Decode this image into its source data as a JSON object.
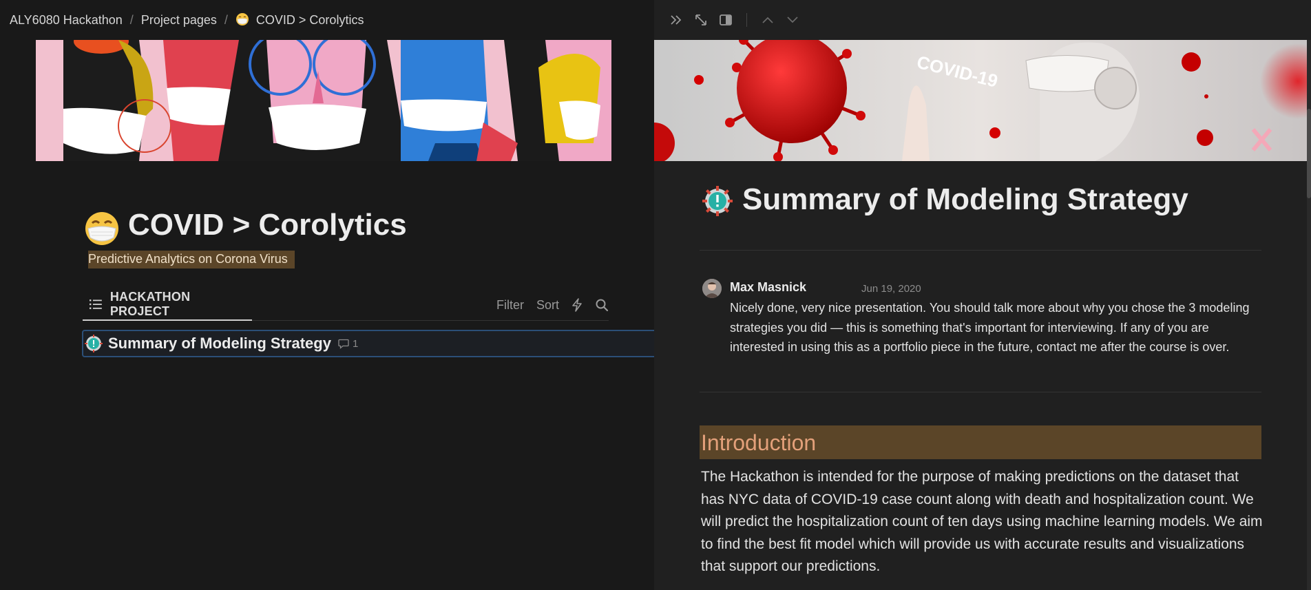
{
  "breadcrumb": {
    "items": [
      "ALY6080 Hackathon",
      "Project pages",
      "COVID > Corolytics"
    ],
    "separator": "/"
  },
  "page": {
    "title": "COVID > Corolytics",
    "subtitle": "Predictive Analytics on Corona Virus",
    "icon": "face-with-medical-mask-icon"
  },
  "database": {
    "tab_label": "HACKATHON PROJECT",
    "actions": {
      "filter": "Filter",
      "sort": "Sort"
    },
    "rows": [
      {
        "title": "Summary of Modeling Strategy",
        "comment_count": "1",
        "icon": "gear-alert-icon"
      }
    ]
  },
  "peek": {
    "title": "Summary of Modeling Strategy",
    "comment": {
      "author": "Max Masnick",
      "date": "Jun 19, 2020",
      "text": "Nicely done, very nice presentation. You should talk more about why you chose the 3 modeling strategies you did — this is something that's important for interviewing. If any of you are interested in using this as a portfolio piece in the future, contact me after the course is over."
    },
    "sections": [
      {
        "heading": "Introduction",
        "body": "The Hackathon is intended for the purpose of making predictions on the dataset that has NYC data of COVID-19 case count along with death and hospitalization count. We will predict the hospitalization count of ten days using machine learning models. We aim to find the best fit model which will provide us with accurate results and visualizations that support our predictions."
      }
    ],
    "cover_text": "COVID-19"
  },
  "colors": {
    "background": "#191919",
    "peek_background": "#202020",
    "highlight_brown": "#5b4528",
    "heading_orange": "#e3a07a",
    "selection_blue": "#2b4f78"
  }
}
